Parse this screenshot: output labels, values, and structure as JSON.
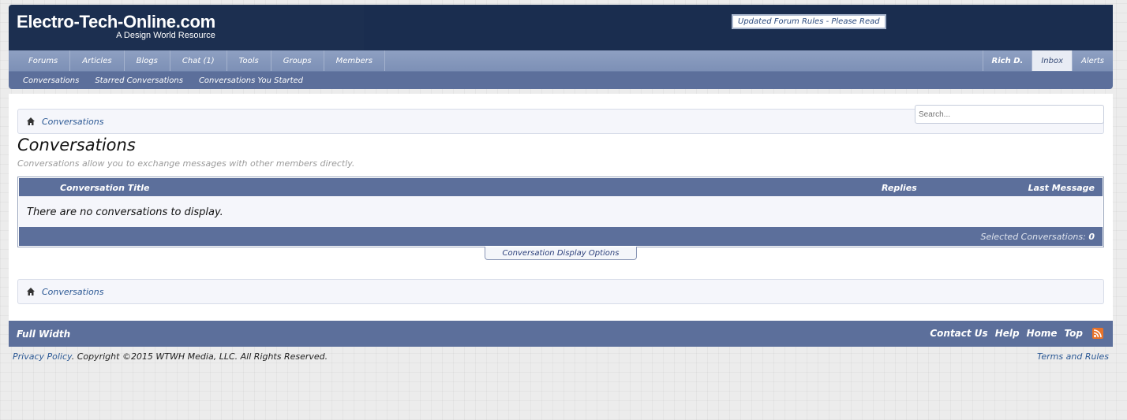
{
  "header": {
    "logo_main": "Electro-Tech-Online.com",
    "logo_sub": "A Design World Resource",
    "notice": "Updated Forum Rules - Please Read"
  },
  "nav": {
    "tabs": [
      {
        "label": "Forums"
      },
      {
        "label": "Articles"
      },
      {
        "label": "Blogs"
      },
      {
        "label": "Chat (1)"
      },
      {
        "label": "Tools"
      },
      {
        "label": "Groups"
      },
      {
        "label": "Members"
      }
    ],
    "user": "Rich D.",
    "inbox": "Inbox",
    "alerts": "Alerts"
  },
  "subnav": {
    "items": [
      {
        "label": "Conversations"
      },
      {
        "label": "Starred Conversations"
      },
      {
        "label": "Conversations You Started"
      }
    ]
  },
  "breadcrumb": {
    "label": "Conversations"
  },
  "search": {
    "placeholder": "Search..."
  },
  "page": {
    "title": "Conversations",
    "description": "Conversations allow you to exchange messages with other members directly."
  },
  "table": {
    "col_title": "Conversation Title",
    "col_replies": "Replies",
    "col_last": "Last Message",
    "empty": "There are no conversations to display.",
    "selected_label": "Selected Conversations:",
    "selected_count": "0"
  },
  "display_options": "Conversation Display Options",
  "footer": {
    "full_width": "Full Width",
    "links": [
      {
        "label": "Contact Us"
      },
      {
        "label": "Help"
      },
      {
        "label": "Home"
      },
      {
        "label": "Top"
      }
    ],
    "privacy": "Privacy Policy",
    "copyright": ". Copyright ©2015 WTWH Media, LLC. All Rights Reserved.",
    "terms": "Terms and Rules"
  },
  "colors": {
    "header_bg": "#1c2f50",
    "nav_bg": "#8ea0c2",
    "bar_bg": "#5c6f9b",
    "link": "#2b5894",
    "rss": "#e8732a"
  },
  "icons": [
    "home-icon",
    "rss-icon"
  ]
}
